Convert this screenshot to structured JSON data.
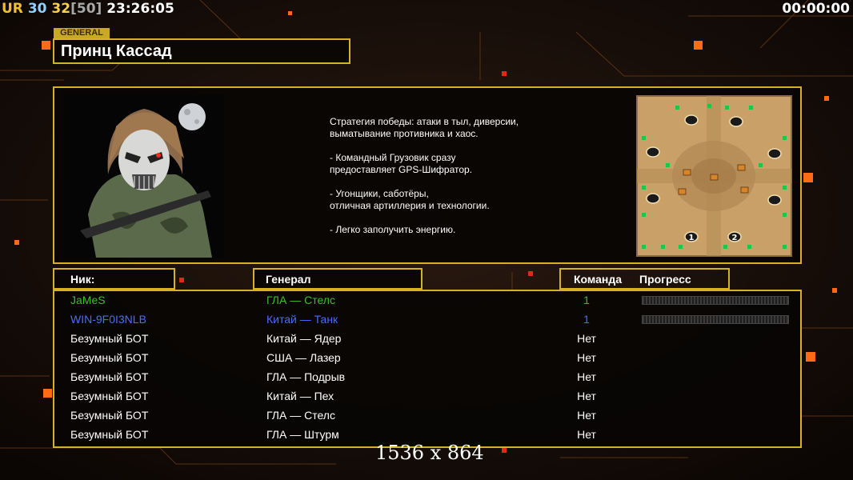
{
  "hud": {
    "ur_label": "UR",
    "fps": "30",
    "frames": "32",
    "cap": "[50]",
    "clock": "23:26:05",
    "game_timer": "00:00:00",
    "colors": {
      "ur_u": "#f0c030",
      "ur_r": "#54c2ff",
      "fps": "#8fd0ff",
      "frames": "#f5d04a",
      "cap": "#a8a8a8",
      "clock": "#ffffff"
    }
  },
  "general": {
    "tag": "GENERAL",
    "name": "Принц Кассад",
    "description": "Стратегия победы: атаки в тыл, диверсии,\n выматывание противника и хаос.\n\n- Командный Грузовик сразу\nпредоставляет GPS-Шифратор.\n\n- Угонщики, саботёры,\nотличная артиллерия и технологии.\n\n- Легко заполучить энергию.",
    "portrait_icon": "masked-soldier-portrait",
    "map_icon": "desert-map-preview",
    "map_start_markers": [
      "1",
      "2"
    ]
  },
  "table": {
    "headers": {
      "nick": "Ник:",
      "general": "Генерал",
      "team": "Команда",
      "progress": "Прогресс"
    },
    "rows": [
      {
        "nick": "JaMeS",
        "general": "ГЛА — Стелс",
        "team": "1",
        "progress": 0,
        "color": "#3fbf2a",
        "show_progress": true
      },
      {
        "nick": "WIN-9F0I3NLB",
        "general": "Китай — Танк",
        "team": "1",
        "progress": 0,
        "color": "#4a6cff",
        "show_progress": true
      },
      {
        "nick": "Безумный БОТ",
        "general": "Китай — Ядер",
        "team": "Нет",
        "color": "#ffffff",
        "show_progress": false
      },
      {
        "nick": "Безумный БОТ",
        "general": "США — Лазер",
        "team": "Нет",
        "color": "#ffffff",
        "show_progress": false
      },
      {
        "nick": "Безумный БОТ",
        "general": "ГЛА — Подрыв",
        "team": "Нет",
        "color": "#ffffff",
        "show_progress": false
      },
      {
        "nick": "Безумный БОТ",
        "general": "Китай — Пех",
        "team": "Нет",
        "color": "#ffffff",
        "show_progress": false
      },
      {
        "nick": "Безумный БОТ",
        "general": "ГЛА — Стелс",
        "team": "Нет",
        "color": "#ffffff",
        "show_progress": false
      },
      {
        "nick": "Безумный БОТ",
        "general": "ГЛА — Штурм",
        "team": "Нет",
        "color": "#ffffff",
        "show_progress": false
      }
    ]
  },
  "resolution_watermark": "1536 x 864",
  "colors": {
    "frame": "#d4b224",
    "accent_orange": "#ff7a1a",
    "background": "#120b08"
  }
}
